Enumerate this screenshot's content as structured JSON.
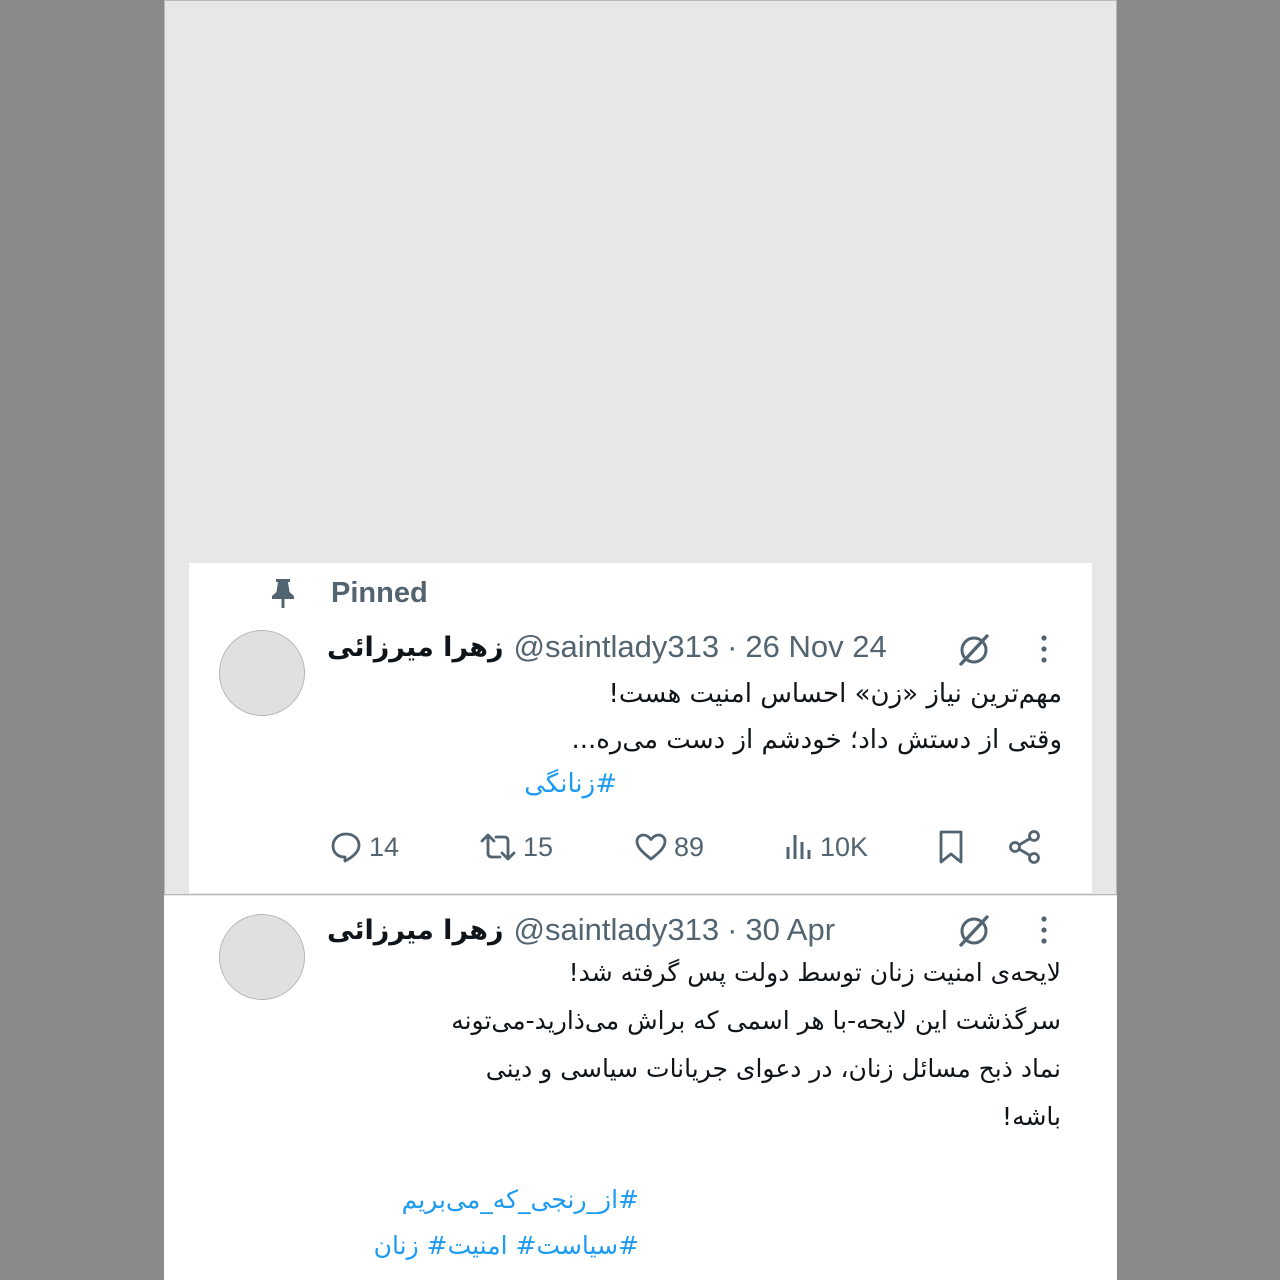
{
  "pinned_label": "Pinned",
  "tweets": [
    {
      "display_name": "زهرا میرزائی",
      "handle": "@saintlady313",
      "separator": "·",
      "date": "26 Nov 24",
      "lines": [
        "مهم‌ترین نیاز «زن» احساس امنیت هست!",
        "وقتی از دستش داد؛ خودشم از دست می‌ره..."
      ],
      "hashtags": [
        "#زنانگی"
      ],
      "replies": "14",
      "reposts": "15",
      "likes": "89",
      "views": "10K"
    },
    {
      "display_name": "زهرا میرزائی",
      "handle": "@saintlady313",
      "separator": "·",
      "date": "30 Apr",
      "lines": [
        "لایحه‌ی امنیت زنان توسط دولت پس گرفته شد!",
        "سرگذشت این لایحه-با هر اسمی که براش می‌ذارید-می‌تونه",
        "نماد ذبح مسائل زنان، در دعوای جریانات سیاسی و دینی",
        "باشه!"
      ],
      "hashtags": [
        "#از_رنجی_که_می‌بریم",
        "#سیاست# امنیت# زنان"
      ]
    }
  ],
  "colors": {
    "text": "#0f1419",
    "secondary": "#536471",
    "link": "#1d9bf0",
    "frame": "#8a8a8a"
  },
  "icons": [
    "pin-icon",
    "grok-icon",
    "more-icon",
    "reply-icon",
    "repost-icon",
    "like-icon",
    "views-icon",
    "bookmark-icon",
    "share-icon"
  ]
}
